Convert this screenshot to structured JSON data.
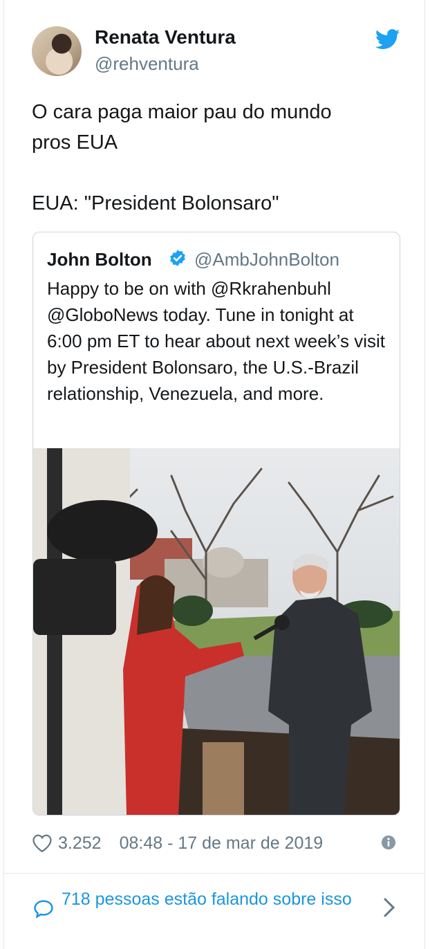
{
  "tweet": {
    "author_name": "Renata Ventura",
    "author_handle": "@rehventura",
    "text": "O cara paga maior pau do mundo\npros EUA\n\nEUA: \"President Bolonsaro\"",
    "likes": "3.252",
    "timestamp": "08:48 - 17 de mar de 2019"
  },
  "quoted": {
    "author_name": "John Bolton",
    "author_handle": "@AmbJohnBolton",
    "text": "Happy to be on with @Rkrahenbuhl @GloboNews today. Tune in tonight at 6:00 pm ET to hear about next week’s visit by President Bolonsaro, the U.S.-Brazil relationship, Venezuela, and more."
  },
  "footer": {
    "talk_text": "718 pessoas estão falando sobre isso"
  },
  "icons": {
    "twitter": "twitter-bird-icon",
    "verified": "verified-badge-icon",
    "like": "heart-icon",
    "info": "info-icon",
    "reply": "speech-bubble-icon",
    "chevron": "chevron-right-icon"
  },
  "colors": {
    "brand_blue": "#1da1f2",
    "link_blue": "#1b95e0",
    "muted": "#657786",
    "border": "#e1e8ed"
  }
}
